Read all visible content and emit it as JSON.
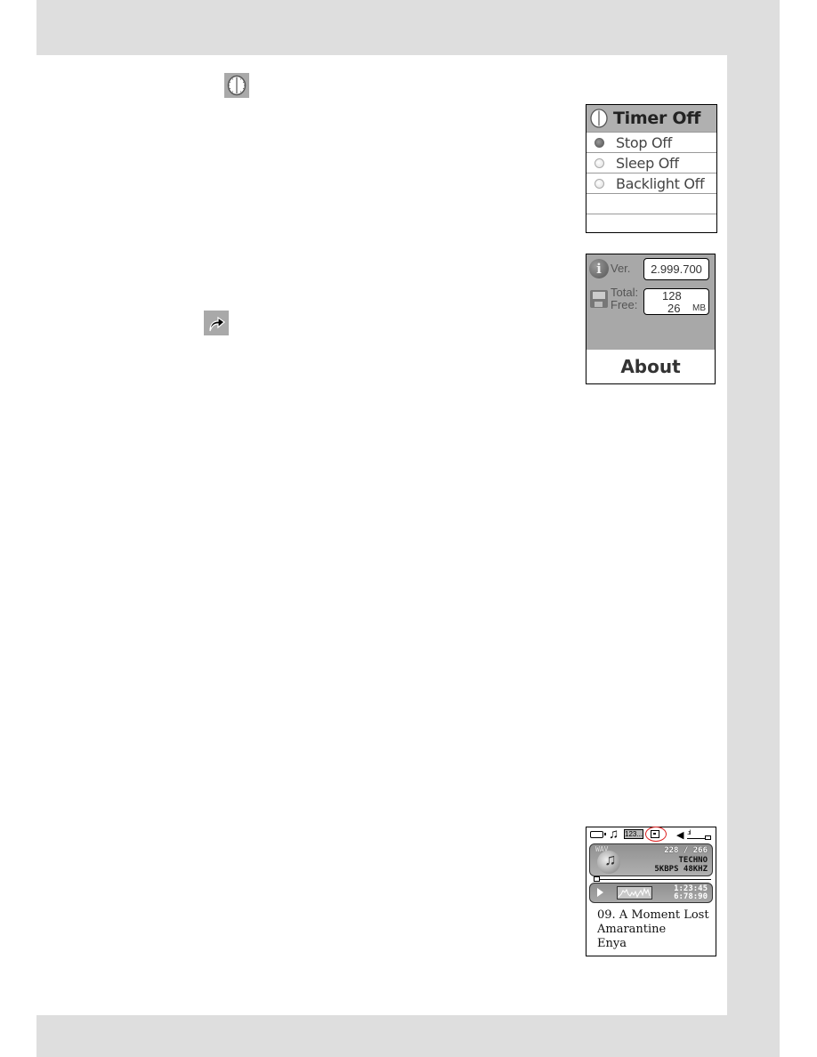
{
  "timer_menu": {
    "title": "Timer Off",
    "options": [
      {
        "label": "Stop Off",
        "selected": true
      },
      {
        "label": "Sleep Off",
        "selected": false
      },
      {
        "label": "Backlight Off",
        "selected": false
      }
    ]
  },
  "about_screen": {
    "version_label": "Ver.",
    "version_value": "2.999.700",
    "total_label": "Total:",
    "free_label": "Free:",
    "total_value": "128",
    "free_value": "26",
    "unit": "MB",
    "title": "About"
  },
  "player_screen": {
    "mode_label": "123...",
    "format": "WAV",
    "track_count": "228 / 266",
    "genre": "TECHNO",
    "bitrate": "5KBPS 48KHZ",
    "elapsed": "1:23:45",
    "total_time": "6:78:90",
    "track_title": "09. A Moment Lost",
    "album": "Amarantine",
    "artist": "Enya",
    "highlight_color": "#d22222"
  },
  "icons": {
    "clock": "clock-icon",
    "return": "return-arrow-icon"
  }
}
